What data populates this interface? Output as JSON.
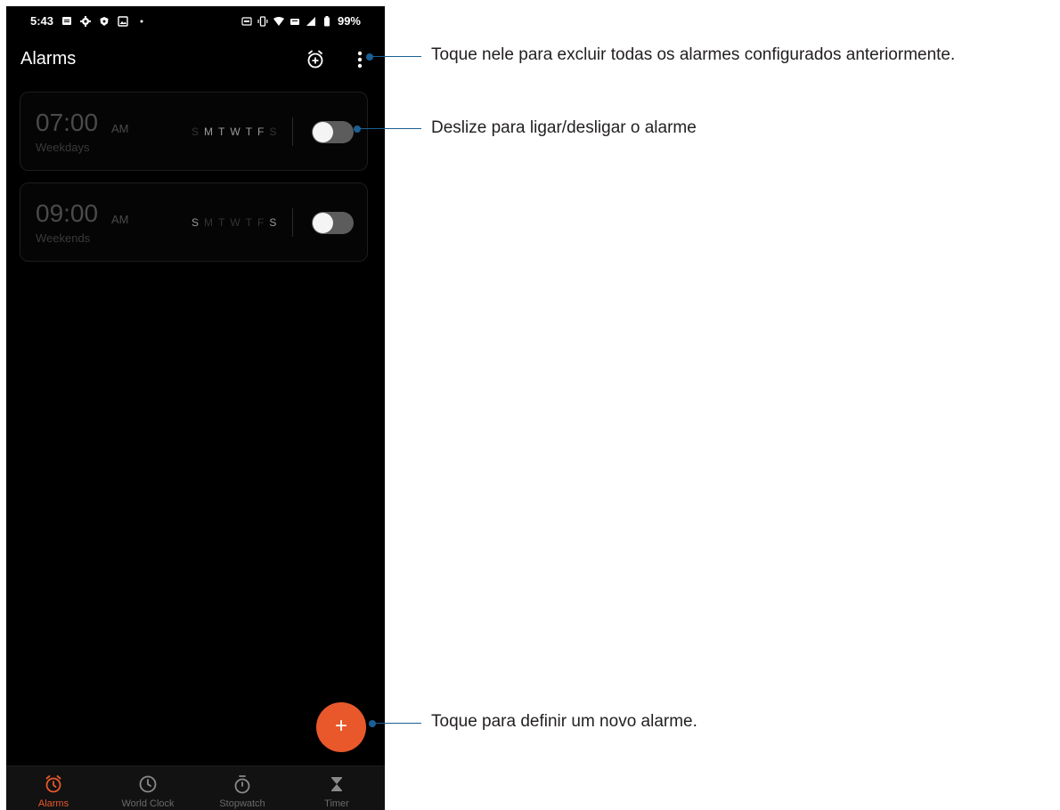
{
  "status_bar": {
    "time": "5:43",
    "battery": "99%"
  },
  "app": {
    "title": "Alarms"
  },
  "alarms": [
    {
      "time": "07:00",
      "ampm": "AM",
      "label": "Weekdays",
      "days": [
        {
          "letter": "S",
          "active": false
        },
        {
          "letter": "M",
          "active": true
        },
        {
          "letter": "T",
          "active": true
        },
        {
          "letter": "W",
          "active": true
        },
        {
          "letter": "T",
          "active": true
        },
        {
          "letter": "F",
          "active": true
        },
        {
          "letter": "S",
          "active": false
        }
      ],
      "enabled": false
    },
    {
      "time": "09:00",
      "ampm": "AM",
      "label": "Weekends",
      "days": [
        {
          "letter": "S",
          "active": true
        },
        {
          "letter": "M",
          "active": false
        },
        {
          "letter": "T",
          "active": false
        },
        {
          "letter": "W",
          "active": false
        },
        {
          "letter": "T",
          "active": false
        },
        {
          "letter": "F",
          "active": false
        },
        {
          "letter": "S",
          "active": true
        }
      ],
      "enabled": false
    }
  ],
  "fab": {
    "icon": "plus-icon",
    "label": "+"
  },
  "bottom_nav": [
    {
      "label": "Alarms",
      "icon": "alarm-clock-icon",
      "active": true
    },
    {
      "label": "World Clock",
      "icon": "clock-icon",
      "active": false
    },
    {
      "label": "Stopwatch",
      "icon": "stopwatch-icon",
      "active": false
    },
    {
      "label": "Timer",
      "icon": "hourglass-icon",
      "active": false
    }
  ],
  "callouts": {
    "menu": "Toque nele para excluir todas os alarmes configurados anteriormente.",
    "toggle": "Deslize para ligar/desligar o alarme",
    "fab": "Toque para definir um novo alarme."
  },
  "colors": {
    "accent": "#e8582b",
    "callout": "#1a5f95",
    "background": "#000000"
  }
}
